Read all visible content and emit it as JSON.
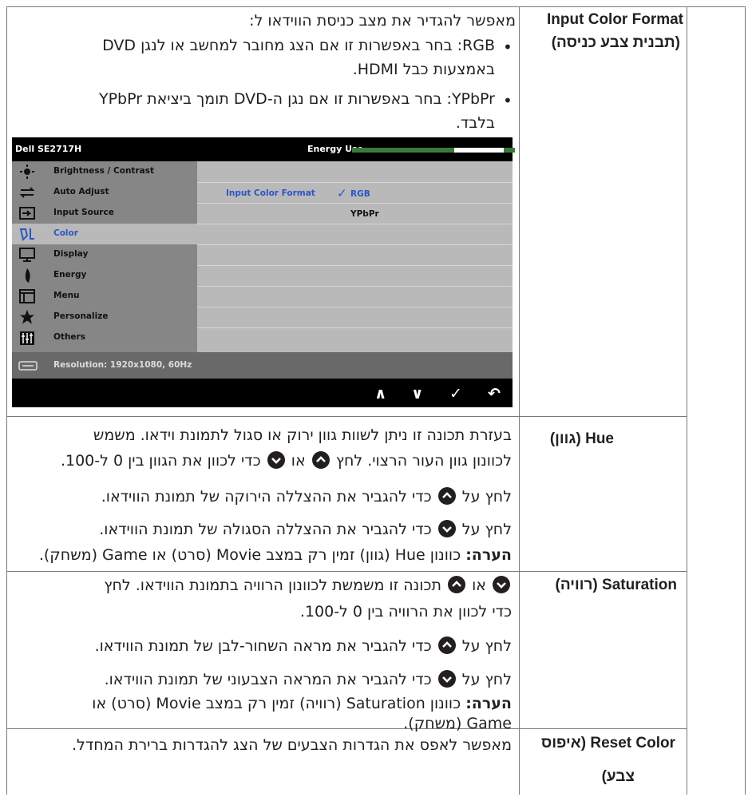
{
  "rows": [
    {
      "header_en": "Input Color Format",
      "header_he": "(תבנית צבע כניסה)",
      "intro": "מאפשר להגדיר את מצב כניסת הווידאו ל:",
      "bullets": [
        {
          "line1": "RGB: בחר באפשרות זו אם הצג מחובר למחשב או לנגן DVD",
          "line2": "באמצעות כבל HDMI."
        },
        {
          "line1": "YPbPr: בחר באפשרות זו אם נגן ה-DVD תומך ביציאת YPbPr",
          "line2": "בלבד."
        }
      ]
    },
    {
      "header": "Hue (גוון)",
      "p1_line1": "בעזרת תכונה זו ניתן לשוות גוון ירוק או סגול לתמונת וידאו. משמש",
      "p1_line2_a": "לכוונון גוון העור הרצוי. לחץ",
      "p1_line2_b": "או",
      "p1_line2_c": "כדי לכוון את הגוון בין 0 ל-100.",
      "p2_a": "לחץ על",
      "p2_b": "כדי להגביר את ההצללה הירוקה של תמונת הווידאו.",
      "p3_a": "לחץ על",
      "p3_b": "כדי להגביר את ההצללה הסגולה של תמונת הווידאו.",
      "note_bold": "הערה:",
      "note_text": "כוונון Hue (גוון) זמין רק במצב Movie (סרט) או Game (משחק)."
    },
    {
      "header": "Saturation (רוויה)",
      "p1_line1_a": "תכונה זו משמשת לכוונון הרוויה בתמונת הווידאו. לחץ",
      "p1_line1_b": "או",
      "p1_line2": "כדי לכוון את הרוויה בין 0 ל-100.",
      "p2_a": "לחץ על",
      "p2_b": "כדי להגביר את מראה השחור-לבן של תמונת הווידאו.",
      "p3_a": "לחץ על",
      "p3_b": "כדי להגביר את המראה הצבעוני של תמונת הווידאו.",
      "note_bold": "הערה:",
      "note_line1": "כוונון Saturation (רוויה) זמין רק במצב Movie (סרט) או",
      "note_line2": "Game (משחק)."
    },
    {
      "header_line1": "Reset Color (איפוס",
      "header_line2": "צבע)",
      "text": "מאפשר לאפס את הגדרות הצבעים של הצג להגדרות ברירת המחדל."
    }
  ],
  "osd": {
    "model": "Dell SE2717H",
    "energy_label": "Energy Use",
    "energy_level": 0.7,
    "menu": [
      {
        "label": "Brightness / Contrast",
        "icon": "brightness-icon"
      },
      {
        "label": "Auto Adjust",
        "icon": "auto-adjust-icon"
      },
      {
        "label": "Input Source",
        "icon": "input-source-icon"
      },
      {
        "label": "Color",
        "icon": "color-icon",
        "selected": true
      },
      {
        "label": "Display",
        "icon": "display-icon"
      },
      {
        "label": "Energy",
        "icon": "energy-icon"
      },
      {
        "label": "Menu",
        "icon": "menu-icon"
      },
      {
        "label": "Personalize",
        "icon": "star-icon"
      },
      {
        "label": "Others",
        "icon": "others-icon"
      }
    ],
    "submenu_label": "Input Color Format",
    "option_rgb": "RGB",
    "option_ypbpr": "YPbPr",
    "resolution": "Resolution: 1920x1080, 60Hz",
    "nav_up": "∧",
    "nav_down": "∨",
    "nav_ok": "✓",
    "nav_back": "↶"
  },
  "colors": {
    "border": "#7a7a7a",
    "selected": "#2a56c6",
    "energy": "#3b7a3b"
  }
}
